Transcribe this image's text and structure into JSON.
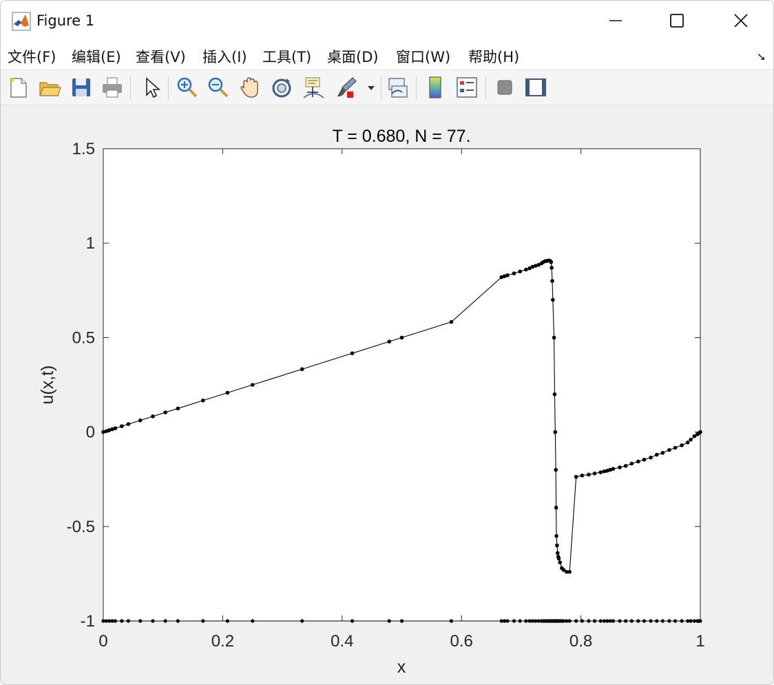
{
  "window": {
    "title": "Figure 1",
    "colors": {
      "titlebar": "#ffffff",
      "figure_bg": "#f0f0f0",
      "axes_bg": "#ffffff",
      "line": "#000000"
    }
  },
  "menu": [
    "文件(F)",
    "编辑(E)",
    "查看(V)",
    "插入(I)",
    "工具(T)",
    "桌面(D)",
    "窗口(W)",
    "帮助(H)"
  ],
  "toolbar": [
    "new-figure-icon",
    "open-file-icon",
    "save-icon",
    "print-icon",
    "pointer-arrow-icon",
    "zoom-in-icon",
    "zoom-out-icon",
    "pan-hand-icon",
    "rotate-3d-icon",
    "data-cursor-icon",
    "brush-icon",
    "link-plot-icon",
    "colorbar-icon",
    "legend-icon",
    "hide-plot-tools-icon",
    "show-plot-tools-icon"
  ],
  "chart_data": {
    "type": "line",
    "title": "T = 0.680,    N =  77.",
    "xlabel": "x",
    "ylabel": "u(x,t)",
    "xlim": [
      0,
      1
    ],
    "ylim": [
      -1,
      1.5
    ],
    "xticks": [
      "0",
      "0.2",
      "0.4",
      "0.6",
      "0.8",
      "1"
    ],
    "yticks": [
      "-1",
      "-0.5",
      "0",
      "0.5",
      "1",
      "1.5"
    ],
    "grid": false,
    "markers": "dot",
    "series": [
      {
        "x": [
          0,
          0.005,
          0.01,
          0.015,
          0.02,
          0.031,
          0.042,
          0.062,
          0.083,
          0.104,
          0.125,
          0.167,
          0.208,
          0.25,
          0.333,
          0.417,
          0.479,
          0.5,
          0.583,
          0.667,
          0.672,
          0.677,
          0.688,
          0.698,
          0.708,
          0.714,
          0.719,
          0.724,
          0.729,
          0.734,
          0.737,
          0.74,
          0.742,
          0.745,
          0.747,
          0.749,
          0.75,
          0.751,
          0.752,
          0.753,
          0.755,
          0.756,
          0.757,
          0.758,
          0.7585,
          0.759,
          0.76,
          0.761,
          0.762,
          0.763,
          0.765,
          0.768,
          0.771,
          0.776,
          0.781,
          0.792,
          0.802,
          0.813,
          0.823,
          0.833,
          0.839,
          0.844,
          0.849,
          0.854,
          0.865,
          0.875,
          0.885,
          0.896,
          0.906,
          0.917,
          0.927,
          0.937,
          0.948,
          0.958,
          0.969,
          0.979,
          0.984,
          0.99,
          0.995,
          0.998,
          1.0
        ],
        "y": [
          0,
          0.005,
          0.01,
          0.015,
          0.02,
          0.031,
          0.042,
          0.062,
          0.083,
          0.104,
          0.125,
          0.167,
          0.208,
          0.25,
          0.333,
          0.417,
          0.479,
          0.5,
          0.583,
          0.82,
          0.825,
          0.83,
          0.84,
          0.85,
          0.86,
          0.867,
          0.875,
          0.88,
          0.885,
          0.893,
          0.9,
          0.905,
          0.905,
          0.908,
          0.908,
          0.905,
          0.9,
          0.87,
          0.8,
          0.7,
          0.5,
          0.2,
          0.0,
          -0.2,
          -0.4,
          -0.55,
          -0.6,
          -0.64,
          -0.66,
          -0.67,
          -0.69,
          -0.72,
          -0.73,
          -0.74,
          -0.74,
          -0.237,
          -0.23,
          -0.225,
          -0.219,
          -0.213,
          -0.208,
          -0.205,
          -0.2,
          -0.195,
          -0.187,
          -0.179,
          -0.167,
          -0.156,
          -0.146,
          -0.135,
          -0.12,
          -0.11,
          -0.095,
          -0.083,
          -0.07,
          -0.055,
          -0.04,
          -0.022,
          -0.012,
          -0.005,
          0.0
        ]
      }
    ]
  }
}
